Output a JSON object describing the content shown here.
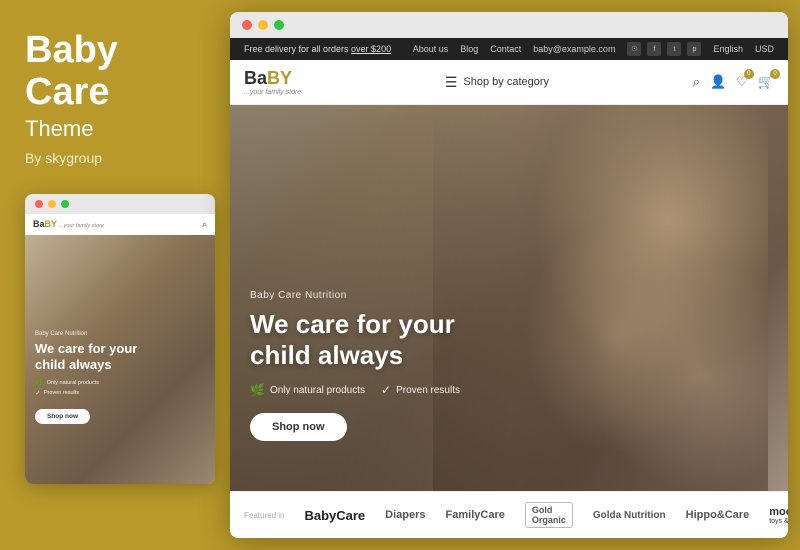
{
  "left": {
    "brand": "Baby\nCare",
    "brand_line1": "Baby",
    "brand_line2": "Care",
    "subtitle": "Theme",
    "by": "By skygroup",
    "preview": {
      "logo": "BaBY",
      "logo_highlight": "a",
      "tagline": "...your family store",
      "category": "Baby Care Nutrition",
      "title_line1": "We care for your",
      "title_line2": "child always",
      "badge1": "Only natural products",
      "badge2": "Proven results",
      "shop_btn": "Shop now"
    }
  },
  "main": {
    "top_bar": {
      "promo": "Free delivery for all orders over $200",
      "promo_highlight": "$200",
      "links": [
        "About us",
        "Blog",
        "Contact"
      ],
      "email": "baby@example.com",
      "lang": "English",
      "currency": "USD"
    },
    "nav": {
      "logo": "BaBY",
      "tagline": "...your family store",
      "shop_category": "Shop by category",
      "icons": [
        "search",
        "user",
        "heart",
        "cart"
      ],
      "cart_badge": "0",
      "heart_badge": "0"
    },
    "hero": {
      "category": "Baby Care Nutrition",
      "title_line1": "We care for your",
      "title_line2": "child always",
      "badge1": "Only natural products",
      "badge2": "Proven results",
      "shop_btn": "Shop now"
    },
    "brands": {
      "featured_label": "Featured in",
      "items": [
        {
          "name": "BabyCare",
          "style": "baby-care"
        },
        {
          "name": "Diapers",
          "style": "diapers"
        },
        {
          "name": "FamilyCare",
          "style": "family-care"
        },
        {
          "name": "Gold Organic",
          "style": "gold"
        },
        {
          "name": "Golda Nutrition",
          "style": "golda"
        },
        {
          "name": "Hippo&Care",
          "style": "hippo"
        },
        {
          "name": "moomy",
          "style": "moomy",
          "sub": "toys & supplies"
        }
      ]
    }
  },
  "dots": {
    "colors": [
      "#ff5f57",
      "#ffbd2e",
      "#28c840"
    ]
  }
}
